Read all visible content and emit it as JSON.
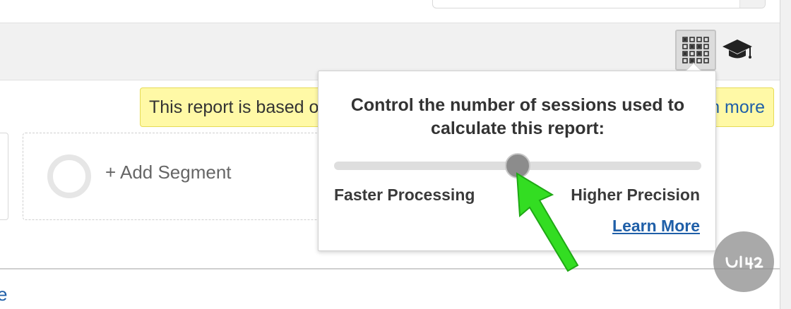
{
  "notice": {
    "text": "This report is based o",
    "link_text": "n more"
  },
  "segments": {
    "add_label": "+ Add Segment"
  },
  "sampling_popover": {
    "title_line1": "Control the number of sessions used to",
    "title_line2": "calculate this report:",
    "slider_value_percent": 50,
    "left_label": "Faster Processing",
    "right_label": "Higher Precision",
    "learn_more": "Learn More"
  },
  "bottom": {
    "link_text": "e"
  },
  "icons": {
    "sampling": "grid-icon",
    "academy": "graduation-cap-icon",
    "annotation": "green-arrow"
  },
  "colors": {
    "accent_link": "#1f5fa8",
    "notice_bg": "#fff9a6",
    "arrow": "#33dd22"
  }
}
